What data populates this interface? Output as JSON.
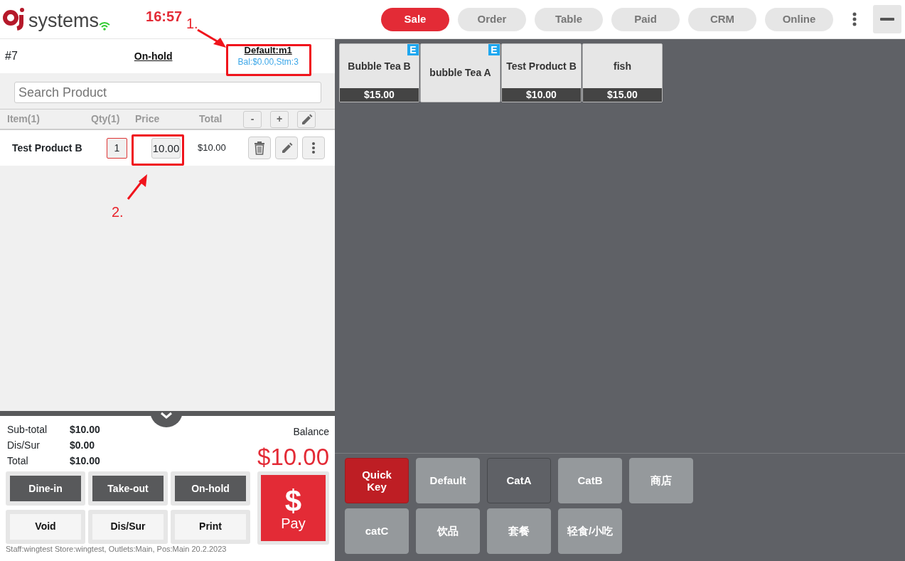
{
  "header": {
    "brand": "systems",
    "time": "16:57",
    "tabs": [
      {
        "label": "Sale",
        "selected": true
      },
      {
        "label": "Order",
        "selected": false
      },
      {
        "label": "Table",
        "selected": false
      },
      {
        "label": "Paid",
        "selected": false
      },
      {
        "label": "CRM",
        "selected": false
      },
      {
        "label": "Online",
        "selected": false
      }
    ]
  },
  "order": {
    "number": "#7",
    "status": "On-hold",
    "customer": "Default:m1",
    "customer_info": "Bal:$0.00,Stm:3"
  },
  "search": {
    "placeholder": "Search Product"
  },
  "table": {
    "columns": [
      "Item(1)",
      "Qty(1)",
      "Price",
      "Total"
    ],
    "header_buttons": [
      "-",
      "+"
    ],
    "rows": [
      {
        "item": "Test Product B",
        "qty": "1",
        "price": "10.00",
        "total": "$10.00"
      }
    ]
  },
  "summary": {
    "lines": [
      {
        "label": "Sub-total",
        "value": "$10.00"
      },
      {
        "label": "Dis/Sur",
        "value": "$0.00"
      },
      {
        "label": "Total",
        "value": "$10.00"
      }
    ],
    "balance_label": "Balance",
    "balance": "$10.00"
  },
  "actions": [
    {
      "label": "Dine-in",
      "kind": "dark"
    },
    {
      "label": "Take-out",
      "kind": "dark"
    },
    {
      "label": "On-hold",
      "kind": "dark"
    },
    {
      "label": "Void",
      "kind": "light"
    },
    {
      "label": "Dis/Sur",
      "kind": "light"
    },
    {
      "label": "Print",
      "kind": "light"
    }
  ],
  "pay": {
    "symbol": "$",
    "label": "Pay"
  },
  "footer": "Staff:wingtest Store:wingtest, Outlets:Main, Pos:Main 20.2.2023",
  "products": [
    {
      "name": "Bubble Tea B",
      "price": "$15.00",
      "badge": "E"
    },
    {
      "name": "bubble Tea A",
      "badge": "E"
    },
    {
      "name": "Test Product B",
      "price": "$10.00"
    },
    {
      "name": "fish",
      "price": "$15.00"
    }
  ],
  "categories": [
    {
      "label": "Quick Key",
      "selected": true,
      "highlighted": false
    },
    {
      "label": "Default",
      "selected": false,
      "highlighted": false
    },
    {
      "label": "CatA",
      "selected": false,
      "highlighted": true
    },
    {
      "label": "CatB",
      "selected": false,
      "highlighted": false
    },
    {
      "label": "商店",
      "selected": false,
      "highlighted": false
    },
    {
      "label": "catC",
      "selected": false,
      "highlighted": false
    },
    {
      "label": "饮品",
      "selected": false,
      "highlighted": false
    },
    {
      "label": "套餐",
      "selected": false,
      "highlighted": false
    },
    {
      "label": "轻食/小吃",
      "selected": false,
      "highlighted": false
    }
  ],
  "annotations": [
    {
      "label": "1."
    },
    {
      "label": "2."
    }
  ]
}
